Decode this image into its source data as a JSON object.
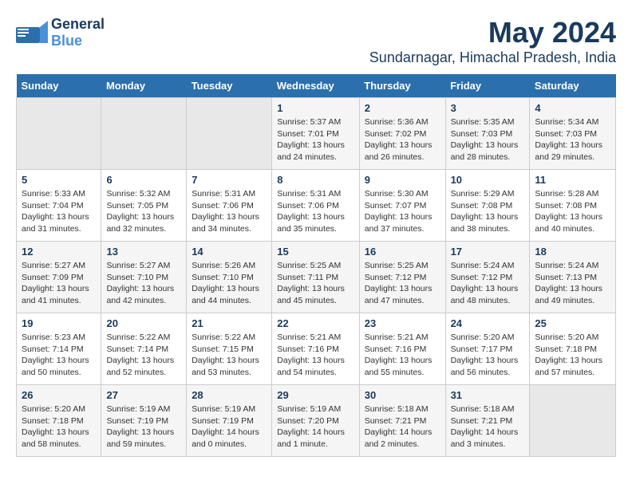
{
  "logo": {
    "general": "General",
    "blue": "Blue"
  },
  "title": {
    "month": "May 2024",
    "location": "Sundarnagar, Himachal Pradesh, India"
  },
  "headers": [
    "Sunday",
    "Monday",
    "Tuesday",
    "Wednesday",
    "Thursday",
    "Friday",
    "Saturday"
  ],
  "weeks": [
    [
      {
        "day": "",
        "info": ""
      },
      {
        "day": "",
        "info": ""
      },
      {
        "day": "",
        "info": ""
      },
      {
        "day": "1",
        "info": "Sunrise: 5:37 AM\nSunset: 7:01 PM\nDaylight: 13 hours\nand 24 minutes."
      },
      {
        "day": "2",
        "info": "Sunrise: 5:36 AM\nSunset: 7:02 PM\nDaylight: 13 hours\nand 26 minutes."
      },
      {
        "day": "3",
        "info": "Sunrise: 5:35 AM\nSunset: 7:03 PM\nDaylight: 13 hours\nand 28 minutes."
      },
      {
        "day": "4",
        "info": "Sunrise: 5:34 AM\nSunset: 7:03 PM\nDaylight: 13 hours\nand 29 minutes."
      }
    ],
    [
      {
        "day": "5",
        "info": "Sunrise: 5:33 AM\nSunset: 7:04 PM\nDaylight: 13 hours\nand 31 minutes."
      },
      {
        "day": "6",
        "info": "Sunrise: 5:32 AM\nSunset: 7:05 PM\nDaylight: 13 hours\nand 32 minutes."
      },
      {
        "day": "7",
        "info": "Sunrise: 5:31 AM\nSunset: 7:06 PM\nDaylight: 13 hours\nand 34 minutes."
      },
      {
        "day": "8",
        "info": "Sunrise: 5:31 AM\nSunset: 7:06 PM\nDaylight: 13 hours\nand 35 minutes."
      },
      {
        "day": "9",
        "info": "Sunrise: 5:30 AM\nSunset: 7:07 PM\nDaylight: 13 hours\nand 37 minutes."
      },
      {
        "day": "10",
        "info": "Sunrise: 5:29 AM\nSunset: 7:08 PM\nDaylight: 13 hours\nand 38 minutes."
      },
      {
        "day": "11",
        "info": "Sunrise: 5:28 AM\nSunset: 7:08 PM\nDaylight: 13 hours\nand 40 minutes."
      }
    ],
    [
      {
        "day": "12",
        "info": "Sunrise: 5:27 AM\nSunset: 7:09 PM\nDaylight: 13 hours\nand 41 minutes."
      },
      {
        "day": "13",
        "info": "Sunrise: 5:27 AM\nSunset: 7:10 PM\nDaylight: 13 hours\nand 42 minutes."
      },
      {
        "day": "14",
        "info": "Sunrise: 5:26 AM\nSunset: 7:10 PM\nDaylight: 13 hours\nand 44 minutes."
      },
      {
        "day": "15",
        "info": "Sunrise: 5:25 AM\nSunset: 7:11 PM\nDaylight: 13 hours\nand 45 minutes."
      },
      {
        "day": "16",
        "info": "Sunrise: 5:25 AM\nSunset: 7:12 PM\nDaylight: 13 hours\nand 47 minutes."
      },
      {
        "day": "17",
        "info": "Sunrise: 5:24 AM\nSunset: 7:12 PM\nDaylight: 13 hours\nand 48 minutes."
      },
      {
        "day": "18",
        "info": "Sunrise: 5:24 AM\nSunset: 7:13 PM\nDaylight: 13 hours\nand 49 minutes."
      }
    ],
    [
      {
        "day": "19",
        "info": "Sunrise: 5:23 AM\nSunset: 7:14 PM\nDaylight: 13 hours\nand 50 minutes."
      },
      {
        "day": "20",
        "info": "Sunrise: 5:22 AM\nSunset: 7:14 PM\nDaylight: 13 hours\nand 52 minutes."
      },
      {
        "day": "21",
        "info": "Sunrise: 5:22 AM\nSunset: 7:15 PM\nDaylight: 13 hours\nand 53 minutes."
      },
      {
        "day": "22",
        "info": "Sunrise: 5:21 AM\nSunset: 7:16 PM\nDaylight: 13 hours\nand 54 minutes."
      },
      {
        "day": "23",
        "info": "Sunrise: 5:21 AM\nSunset: 7:16 PM\nDaylight: 13 hours\nand 55 minutes."
      },
      {
        "day": "24",
        "info": "Sunrise: 5:20 AM\nSunset: 7:17 PM\nDaylight: 13 hours\nand 56 minutes."
      },
      {
        "day": "25",
        "info": "Sunrise: 5:20 AM\nSunset: 7:18 PM\nDaylight: 13 hours\nand 57 minutes."
      }
    ],
    [
      {
        "day": "26",
        "info": "Sunrise: 5:20 AM\nSunset: 7:18 PM\nDaylight: 13 hours\nand 58 minutes."
      },
      {
        "day": "27",
        "info": "Sunrise: 5:19 AM\nSunset: 7:19 PM\nDaylight: 13 hours\nand 59 minutes."
      },
      {
        "day": "28",
        "info": "Sunrise: 5:19 AM\nSunset: 7:19 PM\nDaylight: 14 hours\nand 0 minutes."
      },
      {
        "day": "29",
        "info": "Sunrise: 5:19 AM\nSunset: 7:20 PM\nDaylight: 14 hours\nand 1 minute."
      },
      {
        "day": "30",
        "info": "Sunrise: 5:18 AM\nSunset: 7:21 PM\nDaylight: 14 hours\nand 2 minutes."
      },
      {
        "day": "31",
        "info": "Sunrise: 5:18 AM\nSunset: 7:21 PM\nDaylight: 14 hours\nand 3 minutes."
      },
      {
        "day": "",
        "info": ""
      }
    ]
  ]
}
